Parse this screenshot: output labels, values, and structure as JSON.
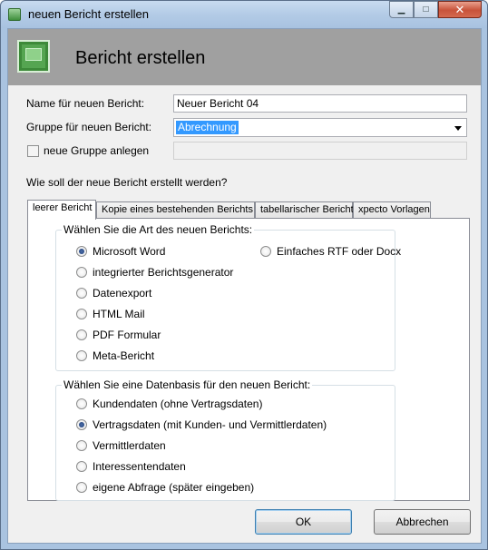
{
  "window": {
    "title": "neuen Bericht erstellen"
  },
  "header": {
    "title": "Bericht erstellen"
  },
  "form": {
    "name_label": "Name für neuen Bericht:",
    "name_value": "Neuer Bericht 04",
    "group_label": "Gruppe für neuen Bericht:",
    "group_value": "Abrechnung",
    "new_group_checkbox_label": "neue Gruppe anlegen",
    "question": "Wie soll der neue Bericht erstellt werden?"
  },
  "tabs": [
    {
      "label": "leerer Bericht"
    },
    {
      "label": "Kopie eines bestehenden Berichts"
    },
    {
      "label": "tabellarischer Bericht"
    },
    {
      "label": "xpecto Vorlagen"
    }
  ],
  "type_group": {
    "legend": "Wählen Sie die Art des neuen Berichts:",
    "options": [
      {
        "label": "Microsoft Word",
        "checked": true
      },
      {
        "label": "integrierter Berichtsgenerator",
        "checked": false
      },
      {
        "label": "Datenexport",
        "checked": false
      },
      {
        "label": "HTML Mail",
        "checked": false
      },
      {
        "label": "PDF Formular",
        "checked": false
      },
      {
        "label": "Meta-Bericht",
        "checked": false
      },
      {
        "label": "Einfaches RTF oder Docx",
        "checked": false
      }
    ]
  },
  "data_group": {
    "legend": "Wählen Sie eine Datenbasis für den neuen Bericht:",
    "options": [
      {
        "label": "Kundendaten (ohne Vertragsdaten)",
        "checked": false
      },
      {
        "label": "Vertragsdaten (mit Kunden- und Vermittlerdaten)",
        "checked": true
      },
      {
        "label": "Vermittlerdaten",
        "checked": false
      },
      {
        "label": "Interessentendaten",
        "checked": false
      },
      {
        "label": "eigene Abfrage (später eingeben)",
        "checked": false
      }
    ]
  },
  "buttons": {
    "ok": "OK",
    "cancel": "Abbrechen"
  }
}
